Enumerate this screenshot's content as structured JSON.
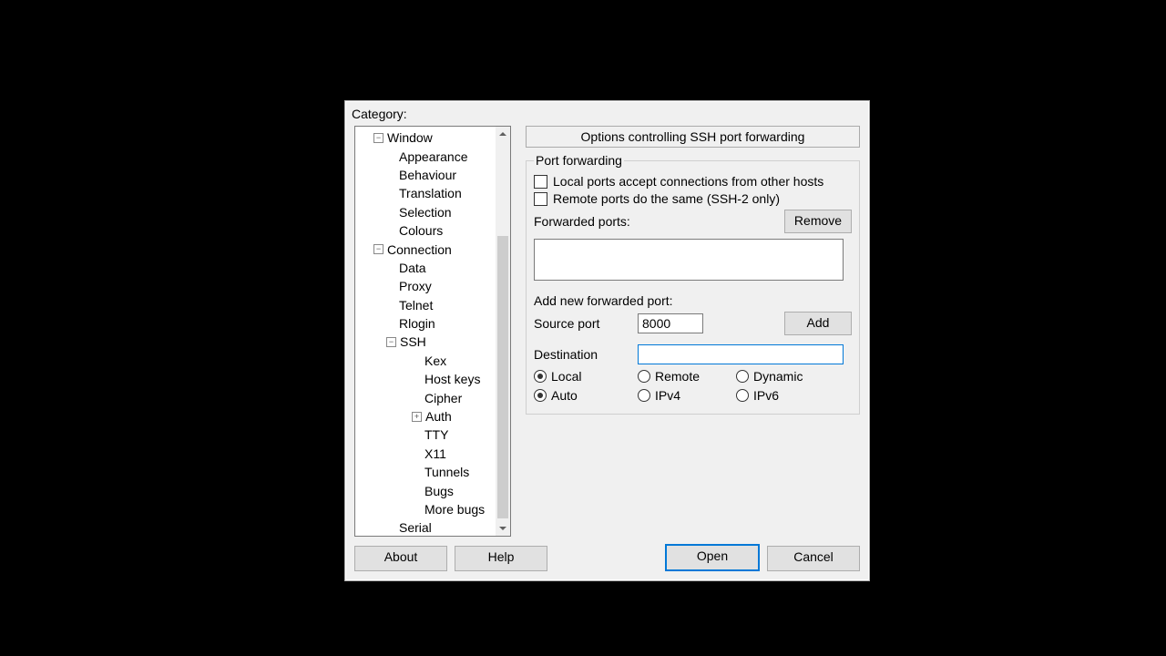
{
  "category_label": "Category:",
  "tree": {
    "items": [
      {
        "label": "Window",
        "indent": 1,
        "expander": "-"
      },
      {
        "label": "Appearance",
        "indent": 2
      },
      {
        "label": "Behaviour",
        "indent": 2
      },
      {
        "label": "Translation",
        "indent": 2
      },
      {
        "label": "Selection",
        "indent": 2
      },
      {
        "label": "Colours",
        "indent": 2
      },
      {
        "label": "Connection",
        "indent": 1,
        "expander": "-"
      },
      {
        "label": "Data",
        "indent": 2
      },
      {
        "label": "Proxy",
        "indent": 2
      },
      {
        "label": "Telnet",
        "indent": 2
      },
      {
        "label": "Rlogin",
        "indent": 2
      },
      {
        "label": "SSH",
        "indent": 2,
        "expander": "-",
        "expander_indent": true
      },
      {
        "label": "Kex",
        "indent": 3
      },
      {
        "label": "Host keys",
        "indent": 3
      },
      {
        "label": "Cipher",
        "indent": 3
      },
      {
        "label": "Auth",
        "indent": 3,
        "expander": "+",
        "expander_indent": true
      },
      {
        "label": "TTY",
        "indent": 3
      },
      {
        "label": "X11",
        "indent": 3
      },
      {
        "label": "Tunnels",
        "indent": 3
      },
      {
        "label": "Bugs",
        "indent": 3
      },
      {
        "label": "More bugs",
        "indent": 3
      },
      {
        "label": "Serial",
        "indent": 2
      }
    ]
  },
  "panel": {
    "title": "Options controlling SSH port forwarding",
    "group": "Port forwarding",
    "chk1": "Local ports accept connections from other hosts",
    "chk2": "Remote ports do the same (SSH-2 only)",
    "fwd_label": "Forwarded ports:",
    "remove": "Remove",
    "add_label": "Add new forwarded port:",
    "src_label": "Source port",
    "src_value": "8000",
    "add": "Add",
    "dst_label": "Destination",
    "dst_value": "",
    "radios1": [
      "Local",
      "Remote",
      "Dynamic"
    ],
    "radios2": [
      "Auto",
      "IPv4",
      "IPv6"
    ],
    "radios1_sel": 0,
    "radios2_sel": 0
  },
  "buttons": {
    "about": "About",
    "help": "Help",
    "open": "Open",
    "cancel": "Cancel"
  }
}
